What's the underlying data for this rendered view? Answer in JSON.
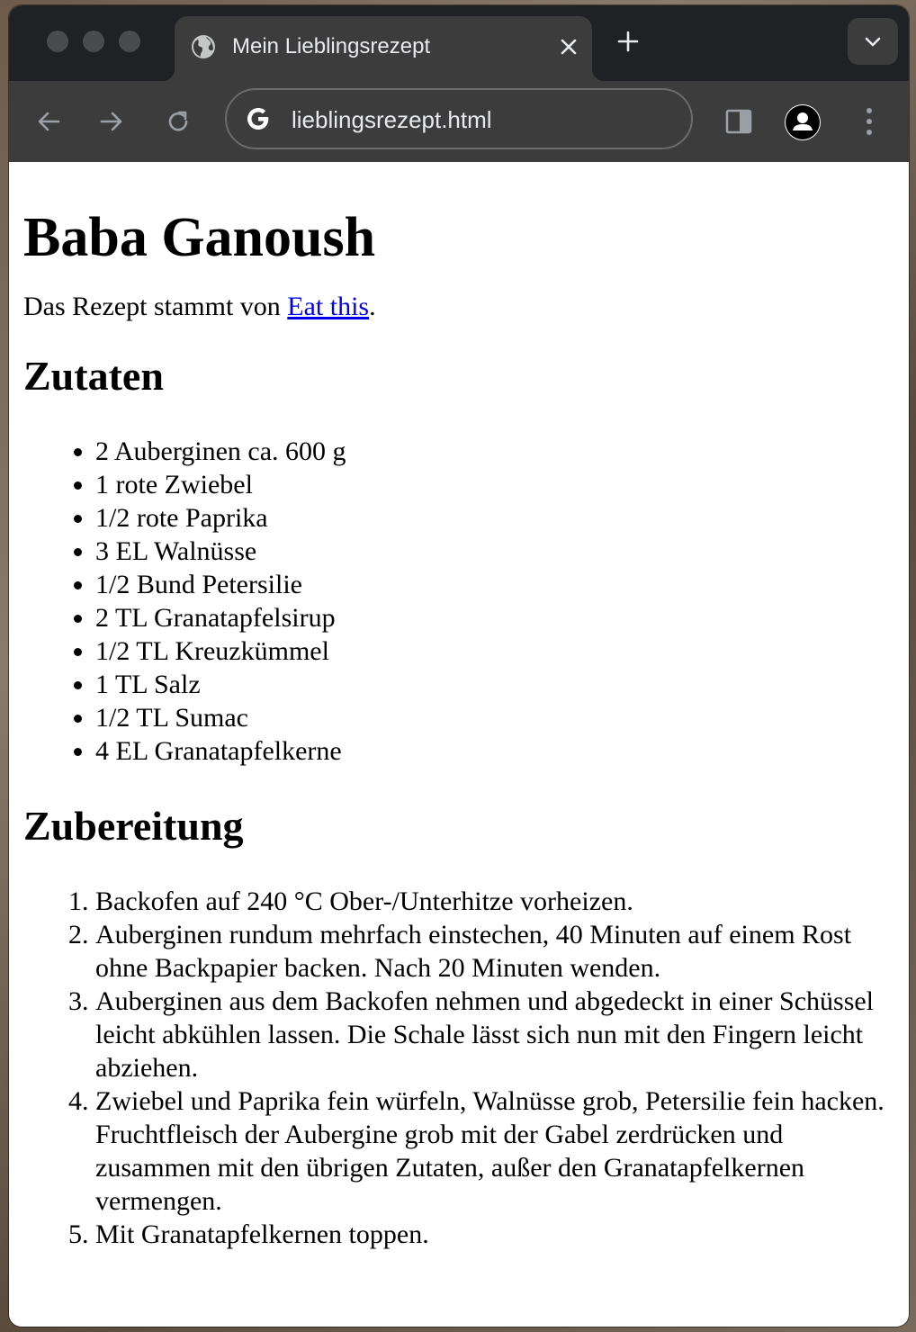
{
  "browser": {
    "tab": {
      "title": "Mein Lieblingsrezept",
      "icon": "globe-icon"
    },
    "address_bar": {
      "url": "lieblingsrezept.html",
      "icon": "google-g-icon"
    }
  },
  "page": {
    "title": "Baba Ganoush",
    "source_prefix": "Das Rezept stammt von ",
    "source_link": "Eat this",
    "source_suffix": ".",
    "ingredients_heading": "Zutaten",
    "ingredients": [
      "2 Auberginen ca. 600 g",
      "1 rote Zwiebel",
      "1/2 rote Paprika",
      "3 EL Walnüsse",
      "1/2 Bund Petersilie",
      "2 TL Granatapfelsirup",
      "1/2 TL Kreuzkümmel",
      "1 TL Salz",
      "1/2 TL Sumac",
      "4 EL Granatapfelkerne"
    ],
    "preparation_heading": "Zubereitung",
    "steps": [
      "Backofen auf 240 °C Ober-/Unterhitze vorheizen.",
      "Auberginen rundum mehrfach einstechen, 40 Minuten auf einem Rost ohne Backpapier backen. Nach 20 Minuten wenden.",
      "Auberginen aus dem Backofen nehmen und abgedeckt in einer Schüssel leicht abkühlen lassen. Die Schale lässt sich nun mit den Fingern leicht abziehen.",
      "Zwiebel und Paprika fein würfeln, Walnüsse grob, Petersilie fein hacken. Fruchtfleisch der Aubergine grob mit der Gabel zerdrücken und zusammen mit den übrigen Zutaten, außer den Granatapfelkernen vermengen.",
      "Mit Granatapfelkernen toppen."
    ]
  },
  "colors": {
    "titlebar": "#202124",
    "toolbar": "#3c3c3c",
    "link": "#0000ee"
  }
}
